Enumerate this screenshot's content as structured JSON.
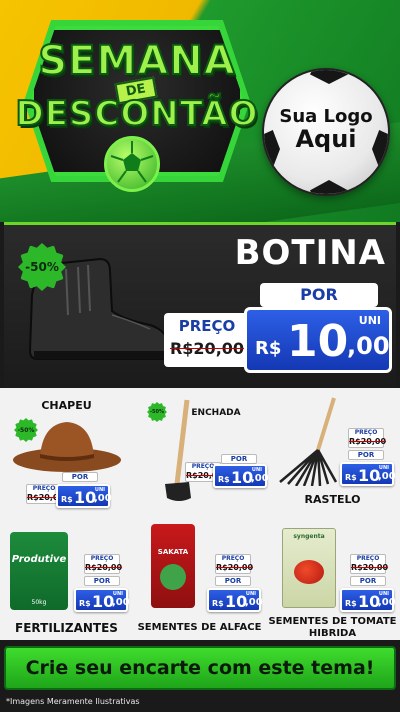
{
  "header": {
    "title_line1": "SEMANA",
    "title_de": "DE",
    "title_line2": "DESCONTÃO",
    "logo_line1": "Sua Logo",
    "logo_line2": "Aqui"
  },
  "featured": {
    "discount_badge": "-50%",
    "name": "BOTINA",
    "por_label": "POR",
    "preco_label": "PREÇO",
    "old_price": "R$20,00",
    "uni_label": "UNI",
    "currency": "R$",
    "price_int": "10",
    "price_cents": ",00"
  },
  "products": [
    {
      "name": "CHAPEU",
      "badge": "-50%",
      "preco_label": "PREÇO",
      "old_price": "R$20,00",
      "por_label": "POR",
      "uni": "UNI",
      "currency": "R$",
      "price_int": "10",
      "price_cents": ",00"
    },
    {
      "name": "ENCHADA",
      "badge": "-50%",
      "preco_label": "PREÇO",
      "old_price": "R$20,00",
      "por_label": "POR",
      "uni": "UNI",
      "currency": "R$",
      "price_int": "10",
      "price_cents": ",00"
    },
    {
      "name": "RASTELO",
      "preco_label": "PREÇO",
      "old_price": "R$20,00",
      "por_label": "POR",
      "uni": "UNI",
      "currency": "R$",
      "price_int": "10",
      "price_cents": ",00"
    },
    {
      "name": "FERTILIZANTES",
      "preco_label": "PREÇO",
      "old_price": "R$20,00",
      "por_label": "POR",
      "uni": "UNI",
      "currency": "R$",
      "price_int": "10",
      "price_cents": ",00",
      "pack_label": "Produtive",
      "pack_weight": "50kg"
    },
    {
      "name": "SEMENTES DE ALFACE",
      "preco_label": "PREÇO",
      "old_price": "R$20,00",
      "por_label": "POR",
      "uni": "UNI",
      "currency": "R$",
      "price_int": "10",
      "price_cents": ",00",
      "pack_label": "SAKATA"
    },
    {
      "name_line1": "SEMENTES DE TOMATE",
      "name_line2": "HIBRIDA",
      "preco_label": "PREÇO",
      "old_price": "R$20,00",
      "por_label": "POR",
      "uni": "UNI",
      "currency": "R$",
      "price_int": "10",
      "price_cents": ",00",
      "pack_label": "syngenta"
    }
  ],
  "cta": {
    "text": "Crie seu encarte com este tema!"
  },
  "disclaimer": "*Imagens Meramente Ilustrativas",
  "colors": {
    "accent_green": "#2db82a",
    "price_blue": "#1f4fd6",
    "brand_yellow": "#f6c400"
  }
}
